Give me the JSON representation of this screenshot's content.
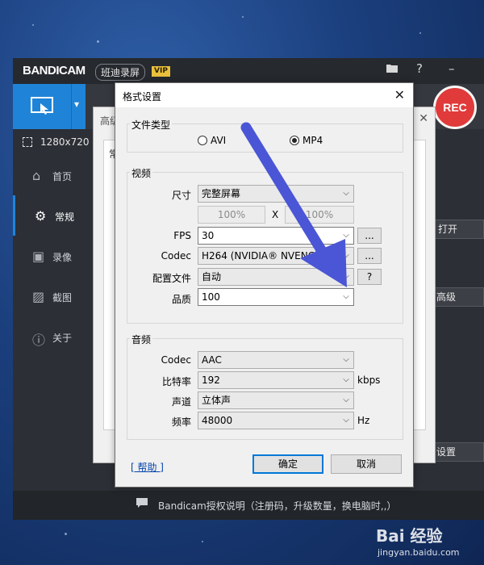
{
  "app": {
    "logo": "BANDICAM",
    "logo_cn": "班迪录屏",
    "vip": "VIP",
    "folder_icon": "folder-icon",
    "help_icon": "?",
    "minimize_icon": "–",
    "rec_label": "REC",
    "resolution": "1280x720 -",
    "sidebar": [
      {
        "icon": "home-icon",
        "glyph": "⌂",
        "label": "首页"
      },
      {
        "icon": "gear-icon",
        "glyph": "⚙",
        "label": "常规"
      },
      {
        "icon": "video-icon",
        "glyph": "▣",
        "label": "录像"
      },
      {
        "icon": "image-icon",
        "glyph": "▨",
        "label": "截图"
      },
      {
        "icon": "info-icon",
        "glyph": "ⓘ",
        "label": "关于"
      }
    ],
    "right_buttons": {
      "open": "打开",
      "advanced": "高级",
      "settings": "设置"
    },
    "status_text": "Bandicam授权说明（注册码，升级数量，换电脑时,,）"
  },
  "bg_dialog": {
    "title": "高级",
    "close": "✕",
    "tab_fragment": "常"
  },
  "format_dialog": {
    "title": "格式设置",
    "close": "✕",
    "file_type": {
      "label": "文件类型",
      "options": [
        "AVI",
        "MP4"
      ],
      "selected": "MP4"
    },
    "video": {
      "label": "视频",
      "size_label": "尺寸",
      "size_value": "完整屏幕",
      "width_pct": "100%",
      "x_label": "X",
      "height_pct": "100%",
      "fps_label": "FPS",
      "fps_value": "30",
      "codec_label": "Codec",
      "codec_value": "H264 (NVIDIA® NVENC)",
      "profile_label": "配置文件",
      "profile_value": "自动",
      "quality_label": "品质",
      "quality_value": "100",
      "more_btn": "...",
      "help_btn": "?"
    },
    "audio": {
      "label": "音频",
      "codec_label": "Codec",
      "codec_value": "AAC",
      "bitrate_label": "比特率",
      "bitrate_value": "192",
      "bitrate_unit": "kbps",
      "channel_label": "声道",
      "channel_value": "立体声",
      "freq_label": "频率",
      "freq_value": "48000",
      "freq_unit": "Hz"
    },
    "help_link": "[ 帮助 ]",
    "ok": "确定",
    "cancel": "取消"
  },
  "watermark": {
    "brand": "Bai 经验",
    "site": "jingyan.baidu.com"
  },
  "colors": {
    "accent": "#1f84d8",
    "rec": "#e03a3a",
    "annotation_arrow": "#4a56d6"
  }
}
